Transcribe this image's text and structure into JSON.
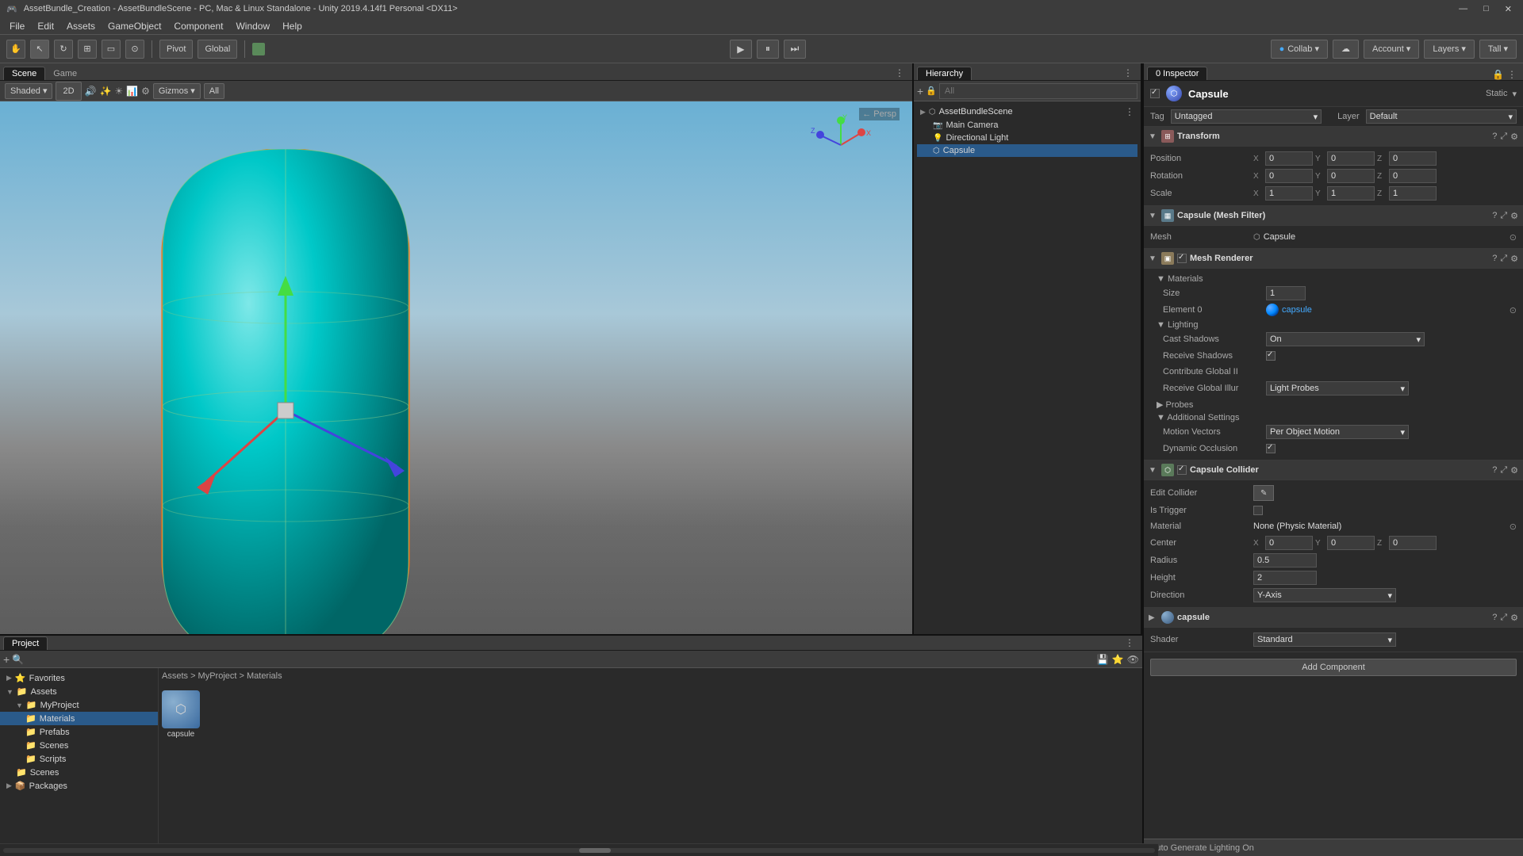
{
  "titlebar": {
    "title": "AssetBundle_Creation - AssetBundleScene - PC, Mac & Linux Standalone - Unity 2019.4.14f1 Personal <DX11>",
    "minimize": "—",
    "maximize": "□",
    "close": "✕"
  },
  "menubar": {
    "items": [
      "File",
      "Edit",
      "Assets",
      "GameObject",
      "Component",
      "Window",
      "Help"
    ]
  },
  "toolbar": {
    "tools": [
      "⊕",
      "↖",
      "⊞",
      "↻",
      "⬡",
      "⊙"
    ],
    "pivot": "Pivot",
    "global": "Global",
    "play": "▶",
    "pause": "⏸",
    "step": "⏭",
    "collab": "Collab ▾",
    "cloud": "☁",
    "account": "Account ▾",
    "layers": "Layers ▾",
    "layout": "Tall ▾"
  },
  "scene_panel": {
    "tabs": [
      "Scene",
      "Game"
    ],
    "toolbar": {
      "shading": "Shaded",
      "mode_2d": "2D",
      "gizmos": "Gizmos",
      "all": "All"
    },
    "persp_label": "← Persp"
  },
  "hierarchy_panel": {
    "title": "Hierarchy",
    "all_label": "All",
    "scene_name": "AssetBundleScene",
    "items": [
      {
        "name": "Main Camera",
        "icon": "📷",
        "indent": 2
      },
      {
        "name": "Directional Light",
        "icon": "☀",
        "indent": 2
      },
      {
        "name": "Capsule",
        "icon": "⬡",
        "indent": 2,
        "selected": true
      }
    ]
  },
  "inspector_panel": {
    "tab": "0 Inspector",
    "object_name": "Capsule",
    "object_static": "Static ▾",
    "tag_label": "Tag",
    "tag_value": "Untagged",
    "layer_label": "Layer",
    "layer_value": "Default",
    "transform": {
      "title": "Transform",
      "position_label": "Position",
      "position_x": "0",
      "position_y": "0",
      "position_z": "0",
      "rotation_label": "Rotation",
      "rotation_x": "0",
      "rotation_y": "0",
      "rotation_z": "0",
      "scale_label": "Scale",
      "scale_x": "1",
      "scale_y": "1",
      "scale_z": "1"
    },
    "mesh_filter": {
      "title": "Capsule (Mesh Filter)",
      "mesh_label": "Mesh",
      "mesh_value": "Capsule"
    },
    "mesh_renderer": {
      "title": "Mesh Renderer",
      "materials_section": "Materials",
      "size_label": "Size",
      "size_value": "1",
      "element0_label": "Element 0",
      "element0_value": "capsule",
      "lighting_section": "Lighting",
      "cast_shadows_label": "Cast Shadows",
      "cast_shadows_value": "On",
      "receive_shadows_label": "Receive Shadows",
      "receive_shadows_checked": true,
      "contribute_gi_label": "Contribute Global II",
      "receive_gi_label": "Receive Global Illur",
      "receive_gi_value": "Light Probes",
      "probes_section": "Probes",
      "additional_settings_section": "Additional Settings",
      "motion_vectors_label": "Motion Vectors",
      "motion_vectors_value": "Per Object Motion",
      "dynamic_occlusion_label": "Dynamic Occlusion",
      "dynamic_occlusion_checked": true
    },
    "capsule_collider": {
      "title": "Capsule Collider",
      "edit_collider_label": "Edit Collider",
      "is_trigger_label": "Is Trigger",
      "material_label": "Material",
      "material_value": "None (Physic Material)",
      "center_label": "Center",
      "center_x": "0",
      "center_y": "0",
      "center_z": "0",
      "radius_label": "Radius",
      "radius_value": "0.5",
      "height_label": "Height",
      "height_value": "2",
      "direction_label": "Direction",
      "direction_value": "Y-Axis"
    },
    "capsule_material": {
      "name": "capsule",
      "shader_label": "Shader",
      "shader_value": "Standard"
    },
    "add_component": "Add Component",
    "auto_generate": "Auto Generate Lighting On"
  },
  "project_panel": {
    "title": "Project",
    "tabs": [
      "Project"
    ],
    "favorites": {
      "label": "Favorites"
    },
    "tree": [
      {
        "label": "Assets",
        "expanded": true,
        "indent": 0
      },
      {
        "label": "MyProject",
        "expanded": true,
        "indent": 1
      },
      {
        "label": "Materials",
        "expanded": false,
        "indent": 2,
        "selected": true
      },
      {
        "label": "Prefabs",
        "expanded": false,
        "indent": 2
      },
      {
        "label": "Scenes",
        "expanded": false,
        "indent": 2
      },
      {
        "label": "Scripts",
        "expanded": false,
        "indent": 2
      },
      {
        "label": "Scenes",
        "expanded": false,
        "indent": 1
      },
      {
        "label": "Packages",
        "expanded": false,
        "indent": 0
      }
    ],
    "breadcrumb": "Assets > MyProject > Materials",
    "asset_name": "capsule"
  }
}
